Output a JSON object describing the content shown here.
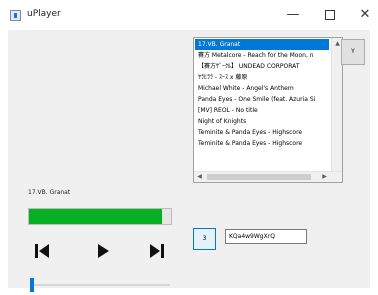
{
  "window": {
    "title": "uPlayer",
    "minimize_glyph": "—",
    "close_glyph": "✕",
    "icon": "java-app-icon"
  },
  "playlist": {
    "items": [
      "17.VB. Granat",
      "賽方 Metalcore - Reach for the Moon, n",
      "【賽方ｻﾞｰｸﾙ】 UNDEAD CORPORAT",
      "ﾔﾗﾋﾗﾗ - ｽｰｽ x 藤原",
      "Michael White - Angel's Anthem",
      "Panda Eyes - One Smile (feat. Azuria Si",
      "[MV] REOL - No title",
      "Night of Knights",
      "Teminite & Panda Eyes - Highscore",
      "Teminite & Panda Eyes - Highscore"
    ],
    "selected_index": 0
  },
  "side_button": {
    "label": "Y"
  },
  "now_playing": {
    "label": "17.VB. Granat"
  },
  "progress": {
    "fraction": 0.94,
    "color": "#06b025"
  },
  "controls": {
    "prev_icon": "skip-previous-icon",
    "play_icon": "play-icon",
    "next_icon": "skip-next-icon"
  },
  "volume": {
    "fraction": 0.0,
    "color": "#0078d7"
  },
  "number_button": {
    "label": "3"
  },
  "text_field": {
    "value": "KQa4w9WgXrQ"
  }
}
